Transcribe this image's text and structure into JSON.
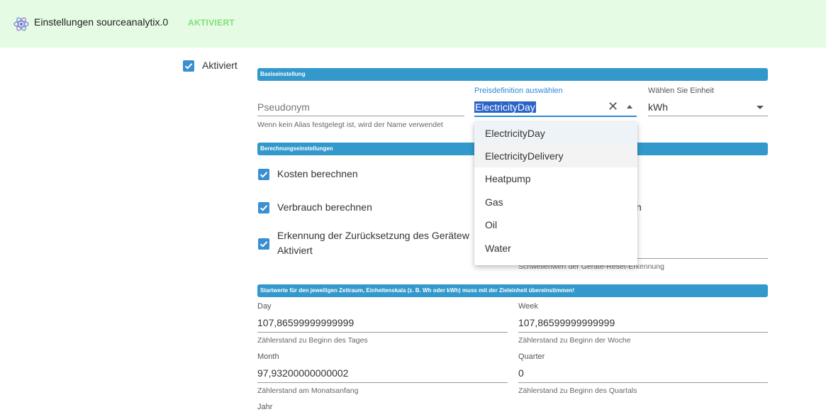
{
  "header": {
    "title": "Einstellungen sourceanalytix.0",
    "badge": "AKTIVIERT",
    "icon": "atom-icon"
  },
  "enabled": {
    "label": "Aktiviert",
    "checked": true
  },
  "basis": {
    "section_title": "Basiseinstellung",
    "pseudonym": {
      "placeholder": "Pseudonym",
      "helper": "Wenn kein Alias festgelegt ist, wird der Name verwendet"
    },
    "price_definition": {
      "label": "Preisdefinition auswählen",
      "value": "ElectricityDay",
      "options": [
        "ElectricityDay",
        "ElectricityDelivery",
        "Heatpump",
        "Gas",
        "Oil",
        "Water"
      ]
    },
    "unit": {
      "label": "Wählen Sie Einheit",
      "value": "kWh"
    }
  },
  "calc": {
    "section_title": "Berechnungseinstellungen",
    "costs": {
      "label": "Kosten berechnen",
      "checked": true
    },
    "consumption": {
      "label": "Verbrauch berechnen",
      "checked": true
    },
    "reset_detect": {
      "label_line1": "Erkennung der Zurücksetzung des Gerätew",
      "label_line2": "Aktiviert",
      "checked": true
    },
    "partial_right_text": "n",
    "threshold_helper": "Schwellenwert der Geräte-Reset-Erkennung"
  },
  "start": {
    "section_title": "Startwerte für den jeweiligen Zeitraum, Einheitenskala (z. B. Wh oder kWh) muss mit der Zieleinheit übereinstimmen!",
    "day": {
      "label": "Day",
      "value": "107,86599999999999",
      "helper": "Zählerstand zu Beginn des Tages"
    },
    "week": {
      "label": "Week",
      "value": "107,86599999999999",
      "helper": "Zählerstand zu Beginn der Woche"
    },
    "month": {
      "label": "Month",
      "value": "97,93200000000002",
      "helper": "Zählerstand am Monatsanfang"
    },
    "quarter": {
      "label": "Quarter",
      "value": "0",
      "helper": "Zählerstand zu Beginn des Quartals"
    },
    "year": {
      "label": "Jahr"
    }
  },
  "colors": {
    "accent": "#3399cc",
    "checkbox": "#3a8fd1",
    "header_bg": "#e5fbe3",
    "badge": "#80e07a"
  }
}
